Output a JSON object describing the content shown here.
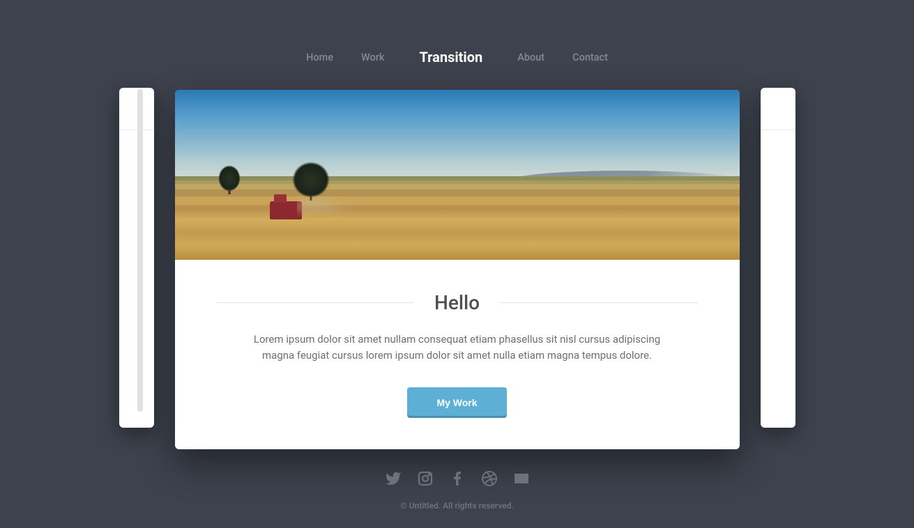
{
  "nav": {
    "left": [
      "Home",
      "Work"
    ],
    "brand": "Transition",
    "right": [
      "About",
      "Contact"
    ]
  },
  "hero": {
    "heading": "Hello",
    "description": "Lorem ipsum dolor sit amet nullam consequat etiam phasellus sit nisl cursus adipiscing magna feugiat cursus lorem ipsum dolor sit amet nulla etiam magna tempus dolore.",
    "cta_label": "My Work"
  },
  "footer": {
    "social": [
      "twitter",
      "instagram",
      "facebook",
      "dribbble",
      "envelope"
    ],
    "copyright": "© Untitled. All rights reserved."
  }
}
